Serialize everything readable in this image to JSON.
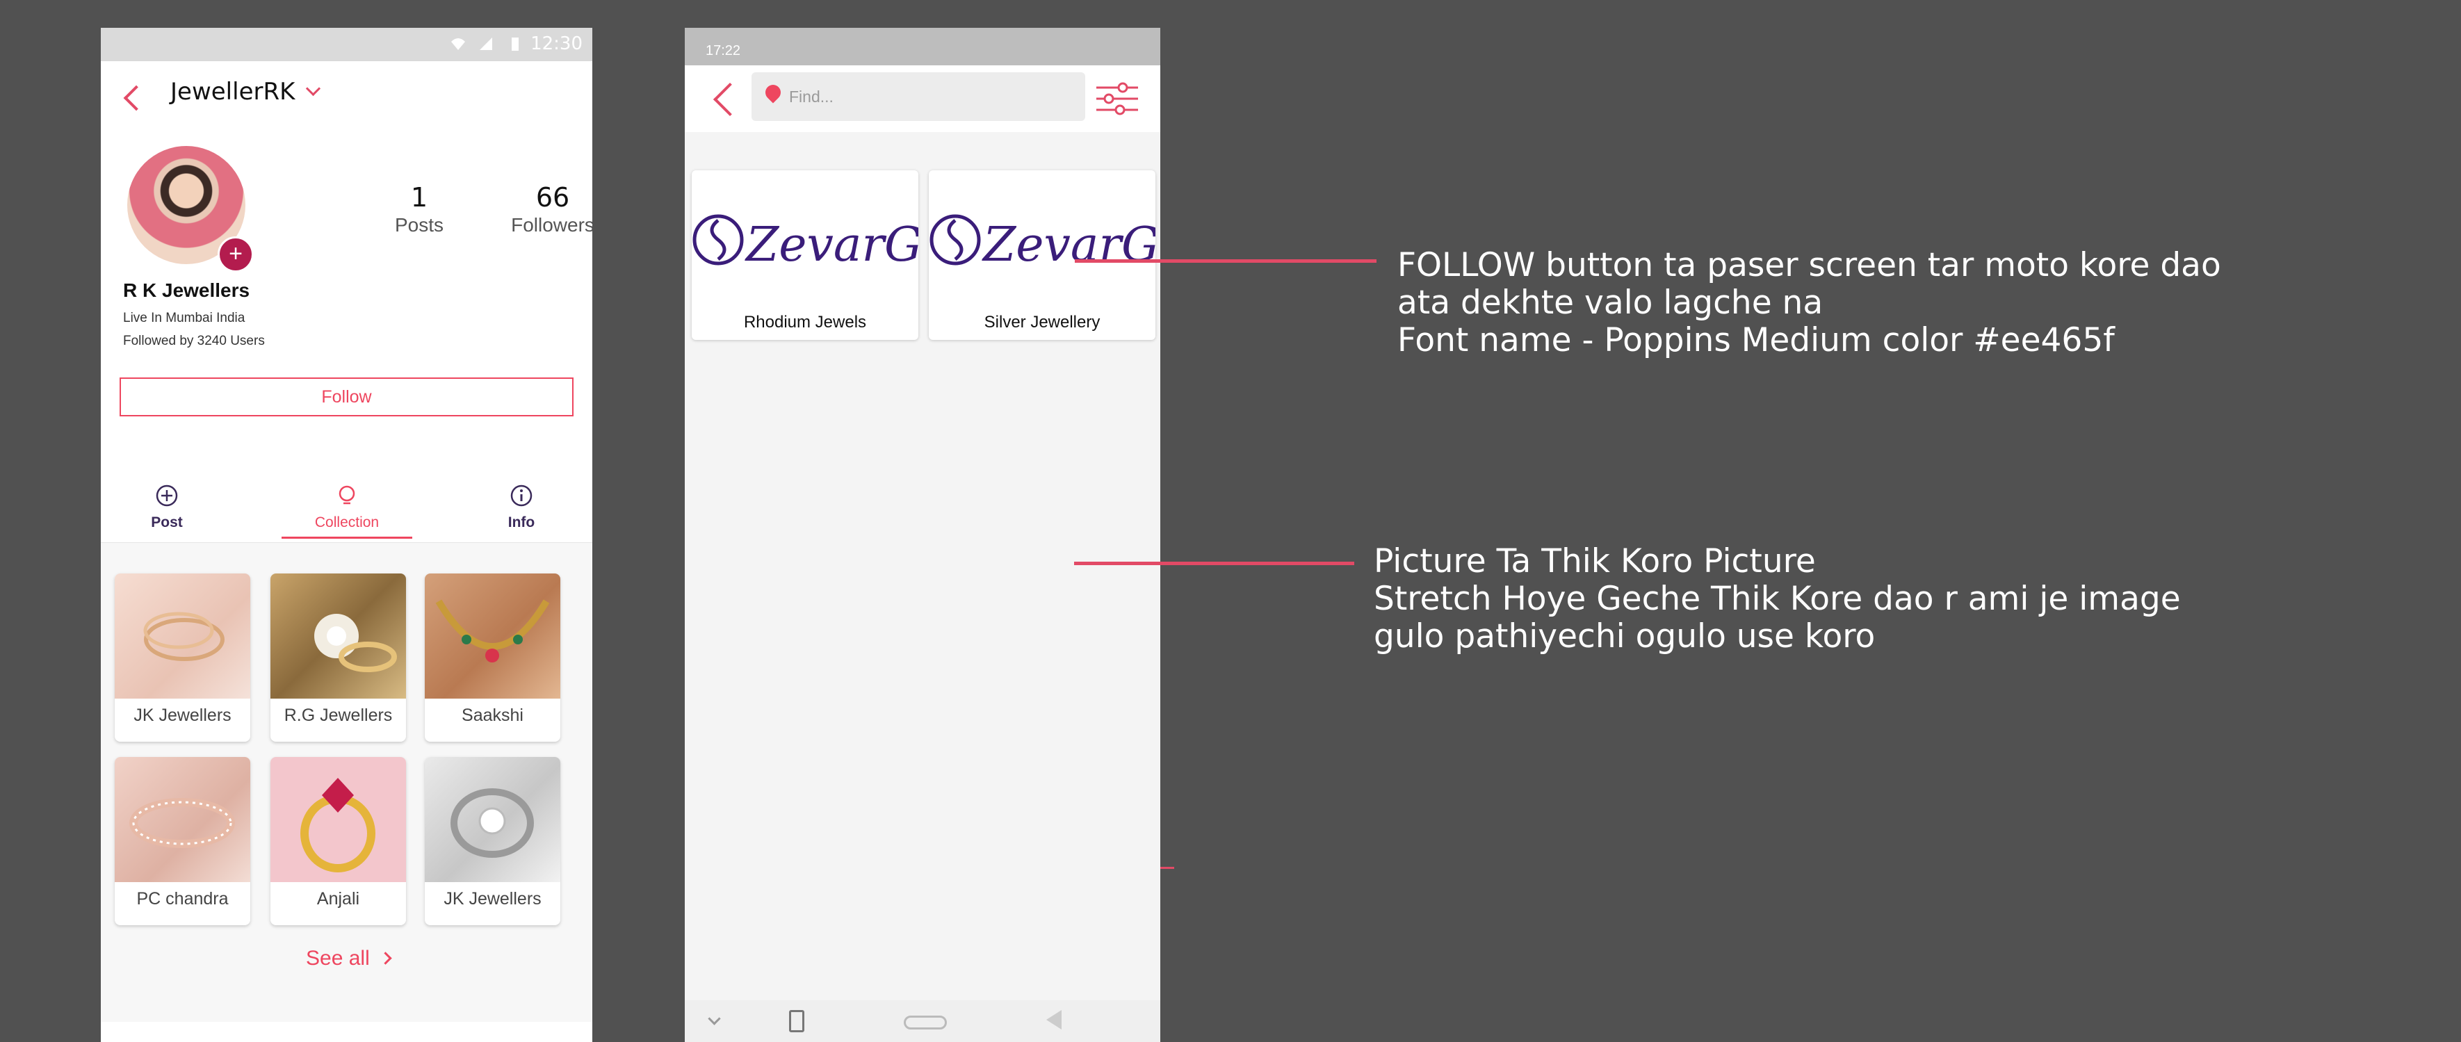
{
  "phone1": {
    "status_time": "12:30",
    "username": "JewellerRK",
    "stats": [
      {
        "num": "1",
        "label": "Posts"
      },
      {
        "num": "66",
        "label": "Followers"
      }
    ],
    "biz_name": "R K Jewellers",
    "biz_location": "Live In Mumbai India",
    "biz_followed": "Followed by 3240 Users",
    "follow_label": "Follow",
    "tabs": [
      {
        "label": "Post",
        "icon": "plus-circle-icon"
      },
      {
        "label": "Collection",
        "icon": "lightbulb-icon"
      },
      {
        "label": "Info",
        "icon": "info-circle-icon"
      }
    ],
    "collections": [
      {
        "label": "JK Jewellers"
      },
      {
        "label": "R.G Jewellers"
      },
      {
        "label": "Saakshi"
      },
      {
        "label": "PC chandra"
      },
      {
        "label": "Anjali"
      },
      {
        "label": "JK Jewellers"
      }
    ],
    "see_all": "See all"
  },
  "phone2": {
    "status_time": "17:22",
    "search_placeholder": "Find...",
    "items": [
      {
        "label": "Rhodium Jewels",
        "logo_text": "ZevarGram"
      },
      {
        "label": "Silver Jewellery",
        "logo_text": "ZevarGram"
      }
    ]
  },
  "annotations": {
    "note1": [
      "FOLLOW button ta paser screen tar moto kore dao",
      "ata dekhte valo lagche na",
      "Font name - Poppins Medium color #ee465f"
    ],
    "note2": [
      "Picture Ta Thik Koro Picture",
      "Stretch Hoye Geche Thik Kore dao r ami je image",
      "gulo pathiyechi ogulo use koro"
    ]
  },
  "colors": {
    "accent": "#ee465f",
    "brand_purple": "#3a1d7a",
    "background": "#515151"
  }
}
